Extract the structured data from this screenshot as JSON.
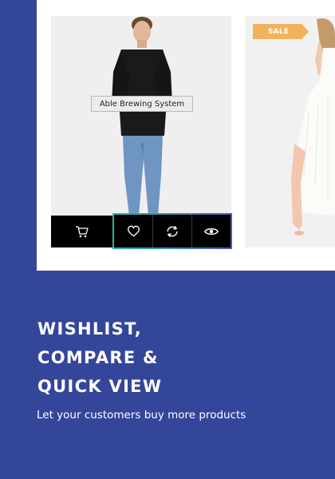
{
  "product_card": {
    "tooltip": "Able Brewing System",
    "icons": {
      "cart": "shopping-cart-icon",
      "wishlist": "heart-icon",
      "compare": "refresh-icon",
      "quick_view": "eye-icon"
    }
  },
  "second_card": {
    "badge": "SALE"
  },
  "feature": {
    "headline_lines": [
      "WISHLIST,",
      "COMPARE &",
      "QUICK VIEW"
    ],
    "subtitle": "Let your customers buy more products"
  },
  "colors": {
    "background": "#34469a",
    "badge": "#f0b35b",
    "action_bar": "#000000",
    "highlight_border_start": "#2bb3a3",
    "highlight_border_end": "#4a5bb5"
  }
}
